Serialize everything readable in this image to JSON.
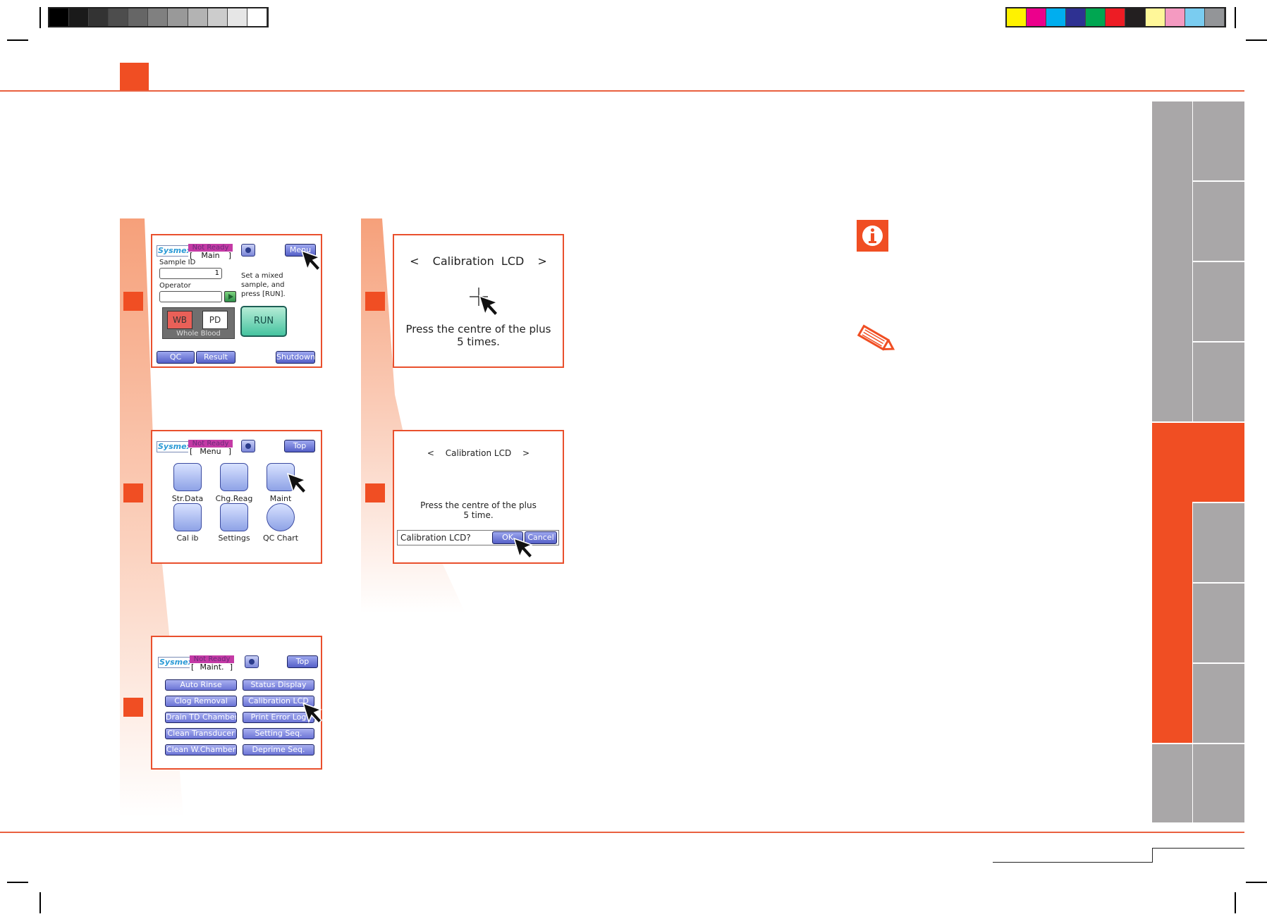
{
  "colors": {
    "accent": "#f04e23",
    "tab_gray": "#a9a7a8",
    "tab_active": "#f04e23",
    "rule": "#e9603f",
    "button_blue": "#6b74d6",
    "status_magenta": "#c43aa5",
    "run_green": "#46c4a0"
  },
  "grayscale_swatches": [
    "#000000",
    "#1a1a1a",
    "#333333",
    "#4d4d4d",
    "#666666",
    "#808080",
    "#999999",
    "#b3b3b3",
    "#cccccc",
    "#e6e6e6",
    "#ffffff"
  ],
  "color_swatches": [
    "#fff200",
    "#ec008c",
    "#00aeef",
    "#2e3192",
    "#00a651",
    "#ed1c24",
    "#231f20",
    "#fff799",
    "#f49ac1",
    "#7accf0",
    "#939598"
  ],
  "icons": [
    "info-icon",
    "pencil-note-icon",
    "pointer-cursor-icon",
    "crosshair-plus-icon"
  ],
  "screen_main": {
    "brand": "Sysmex",
    "status": "Not Ready",
    "screen_name": "Main",
    "bracket_open": "[",
    "bracket_close": "]",
    "menu_button": "Menu",
    "sample_id_label": "Sample ID",
    "sample_id_value": "1",
    "operator_label": "Operator",
    "operator_value": "",
    "instruction_line1": "Set a mixed",
    "instruction_line2": "sample, and",
    "instruction_line3": "press [RUN].",
    "mode_wb": "WB",
    "mode_pd": "PD",
    "mode_caption": "Whole Blood",
    "run_button": "RUN",
    "qc_button": "QC",
    "result_button": "Result",
    "shutdown_button": "Shutdown"
  },
  "screen_menu": {
    "brand": "Sysmex",
    "status": "Not Ready",
    "screen_name": "Menu",
    "bracket_open": "[",
    "bracket_close": "]",
    "top_button": "Top",
    "items": [
      {
        "label": "Str.Data",
        "icon": "stored-data-icon"
      },
      {
        "label": "Chg.Reag",
        "icon": "change-reagent-icon"
      },
      {
        "label": "Maint",
        "icon": "maintenance-icon"
      },
      {
        "label": "Cal ib",
        "icon": "calibration-icon"
      },
      {
        "label": "Settings",
        "icon": "settings-icon"
      },
      {
        "label": "QC Chart",
        "icon": "qc-chart-icon"
      }
    ]
  },
  "screen_maint": {
    "brand": "Sysmex",
    "status": "Not Ready",
    "screen_name": "Maint.",
    "bracket_open": "[",
    "bracket_close": "]",
    "top_button": "Top",
    "buttons_left": [
      "Auto Rinse",
      "Clog Removal",
      "Drain TD Chamber",
      "Clean Transducer",
      "Clean W.Chamber"
    ],
    "buttons_right": [
      "Status Display",
      "Calibration LCD",
      "Print Error Log",
      "Setting Seq.",
      "Deprime Seq."
    ]
  },
  "screen_calib1": {
    "arrow_left": "<",
    "title": "Calibration  LCD",
    "arrow_right": ">",
    "instruction_line1": "Press the centre of the plus",
    "instruction_line2": "5 times."
  },
  "screen_calib2": {
    "arrow_left": "<",
    "title": "Calibration LCD",
    "arrow_right": ">",
    "instruction_line1": "Press the centre of the plus",
    "instruction_line2": "5 time.",
    "confirm_prompt": "Calibration LCD?",
    "ok_button": "OK",
    "cancel_button": "Cancel"
  }
}
